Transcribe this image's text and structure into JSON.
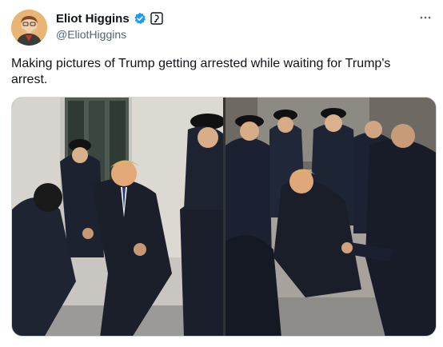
{
  "author": {
    "display_name": "Eliot Higgins",
    "handle": "@EliotHiggins",
    "avatar_icon": "avatar-caricature",
    "verified_icon": "verified-badge-icon",
    "verified_color": "#1d9bf0",
    "affiliate_icon": "affiliate-badge-icon"
  },
  "menu": {
    "more_icon": "more-horizontal-icon"
  },
  "tweet": {
    "text": "Making pictures of Trump getting arrested while waiting for Trump's arrest."
  },
  "media": {
    "images": [
      {
        "name": "ai-image-left"
      },
      {
        "name": "ai-image-right"
      }
    ]
  },
  "colors": {
    "text_primary": "#0f1419",
    "text_secondary": "#536471",
    "border": "#cfd9de"
  }
}
